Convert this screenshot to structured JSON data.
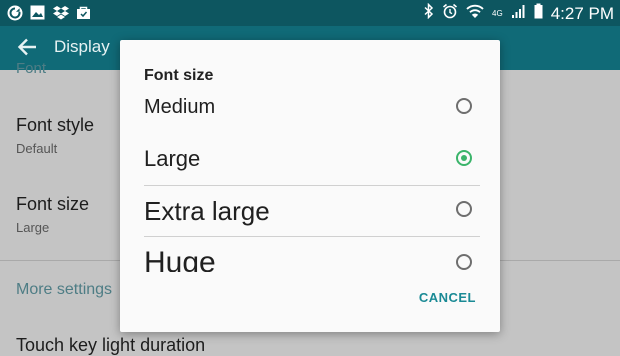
{
  "status_bar": {
    "left_icons": [
      "sync-icon",
      "gallery-icon",
      "dropbox-icon",
      "bag-icon"
    ],
    "right_icons": [
      "bluetooth-icon",
      "alarm-icon",
      "wifi-icon",
      "lte-icon",
      "signal-icon",
      "battery-icon"
    ],
    "network_label": "4G",
    "time": "4:27 PM"
  },
  "app_bar": {
    "title": "Display"
  },
  "settings_list": {
    "section_font_label": "Font",
    "items": [
      {
        "title": "Font style",
        "subtitle": "Default"
      },
      {
        "title": "Font size",
        "subtitle": "Large"
      }
    ],
    "more_settings_label": "More settings",
    "touch_key_label": "Touch key light duration"
  },
  "dialog": {
    "title": "Font size",
    "options": [
      {
        "label": "Medium",
        "selected": false
      },
      {
        "label": "Large",
        "selected": true
      },
      {
        "label": "Extra large",
        "selected": false
      },
      {
        "label": "Huge",
        "selected": false
      }
    ],
    "cancel_label": "CANCEL",
    "accent_color": "#3ab46a"
  },
  "colors": {
    "status_bar": "#0d5660",
    "app_bar": "#106a77",
    "link": "#1a8a95"
  }
}
